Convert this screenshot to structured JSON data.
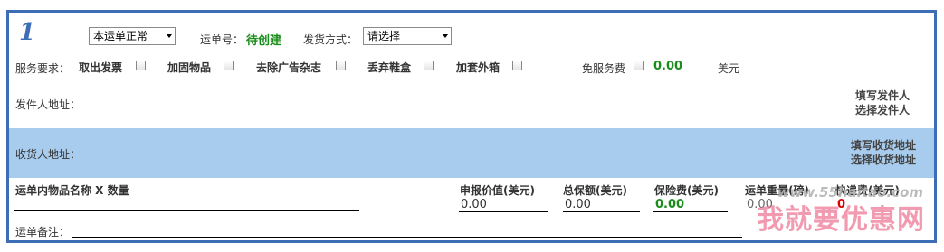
{
  "order": {
    "index": "1",
    "status_select": "本运单正常",
    "waybill_label": "运单号：",
    "waybill_value": "待创建",
    "shipping_label": "发货方式：",
    "shipping_select": "请选择"
  },
  "services": {
    "label": "服务要求：",
    "items": [
      "取出发票",
      "加固物品",
      "去除广告杂志",
      "丢弃鞋盒",
      "加套外箱"
    ],
    "free_fee_label": "免服务费",
    "fee_value": "0.00",
    "currency": "美元"
  },
  "sender": {
    "label": "发件人地址：",
    "fill_link": "填写发件人",
    "select_link": "选择发件人"
  },
  "receiver": {
    "label": "收货人地址：",
    "fill_link": "填写收货地址",
    "select_link": "选择收货地址"
  },
  "items_table": {
    "name_header": "运单内物品名称 X 数量",
    "declared_header": "申报价值(美元)",
    "declared_value": "0.00",
    "insured_header": "总保额(美元)",
    "insured_value": "0.00",
    "premium_header": "保险费(美元)",
    "premium_value": "0.00",
    "weight_header": "运单重量(磅)",
    "weight_value": "0.00",
    "shipping_fee_header": "快递费(美元)",
    "shipping_fee_value": "0"
  },
  "remark": {
    "label": "运单备注："
  },
  "watermark": {
    "url": "www.55haitao.com",
    "text": "我就要优惠网"
  },
  "colors": {
    "border": "#3d6db5",
    "band": "#a8ccee",
    "green": "#1a8c1a",
    "index": "#3d6db5"
  }
}
